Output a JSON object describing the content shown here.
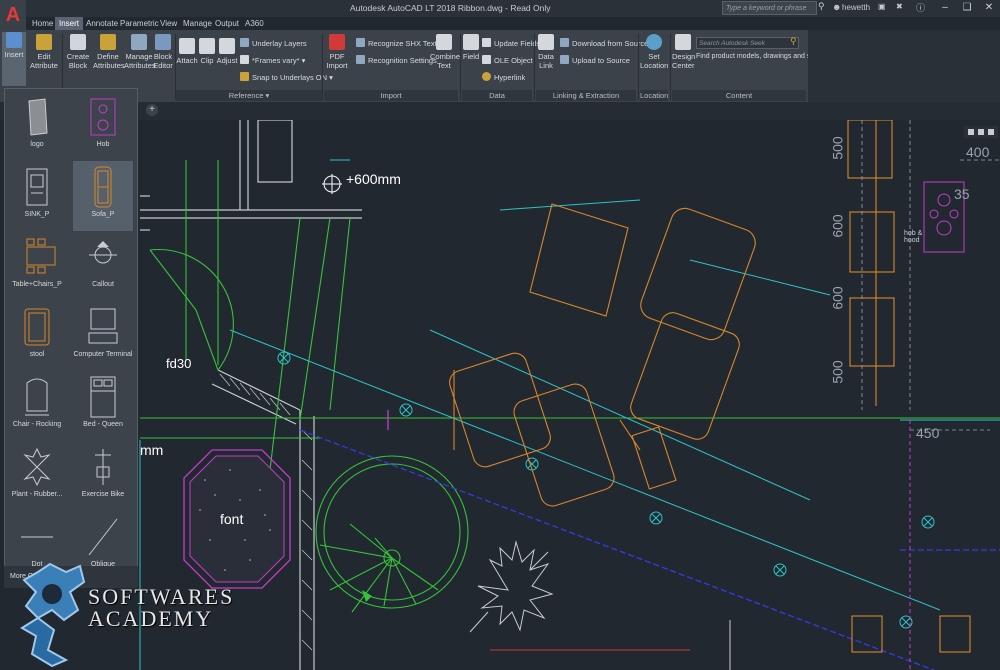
{
  "window": {
    "title": "Autodesk AutoCAD LT 2018    Ribbon.dwg - Read Only",
    "search_placeholder": "Type a keyword or phrase",
    "user": "hewetth",
    "app_letter": "A"
  },
  "tabs": [
    "Home",
    "Insert",
    "Annotate",
    "Parametric",
    "View",
    "Manage",
    "Output",
    "A360"
  ],
  "active_tab": "Insert",
  "ribbon": {
    "insert": "Insert",
    "edit_attribute": "Edit Attribute",
    "create_block": "Create Block",
    "define_attributes": "Define Attributes",
    "manage_attributes": "Manage Attributes",
    "block_editor": "Block Editor",
    "attach": "Attach",
    "clip": "Clip",
    "adjust": "Adjust",
    "underlay_layers": "Underlay Layers",
    "frames_vary": "*Frames vary*",
    "snap_underlays": "Snap to Underlays ON",
    "pdf_import": "PDF Import",
    "recognize_shx": "Recognize SHX Text",
    "recognition_settings": "Recognition Settings",
    "combine_text": "Combine Text",
    "field": "Field",
    "update_fields": "Update Fields",
    "ole_object": "OLE Object",
    "hyperlink": "Hyperlink",
    "data_link": "Data Link",
    "download_source": "Download from Source",
    "upload_source": "Upload to Source",
    "set_location": "Set Location",
    "design_center": "Design Center",
    "seek_placeholder": "Search Autodesk Seek",
    "seek_desc": "Find product models, drawings and specs",
    "panel_reference": "Reference",
    "panel_import": "Import",
    "panel_data": "Data",
    "panel_linking": "Linking & Extraction",
    "panel_location": "Location",
    "panel_content": "Content"
  },
  "palette": {
    "items": [
      "logo",
      "Hob",
      "SINK_P",
      "Sofa_P",
      "Table+Chairs_P",
      "Callout",
      "stool",
      "Computer Terminal",
      "Chair - Rocking",
      "Bed - Queen",
      "Plant - Rubber...",
      "Exercise Bike",
      "Dot",
      "Oblique"
    ],
    "selected": "Sofa_P",
    "more": "More Op"
  },
  "drawing": {
    "coord_label": "+600mm",
    "door_label": "fd30",
    "unit_label": "mm",
    "font_label": "font",
    "hob_label": "hob & hood",
    "dims": [
      "500",
      "600",
      "600",
      "500",
      "400",
      "450",
      "35"
    ]
  },
  "watermark": {
    "line1": "SOFTWARES",
    "line2": "ACADEMY"
  },
  "colors": {
    "background": "#212830",
    "ribbon": "#3b424a",
    "orange": "#d8862a",
    "green": "#36c23a",
    "cyan": "#2ec4c8",
    "magenta": "#c23ec8",
    "blue": "#2f3fe0"
  }
}
